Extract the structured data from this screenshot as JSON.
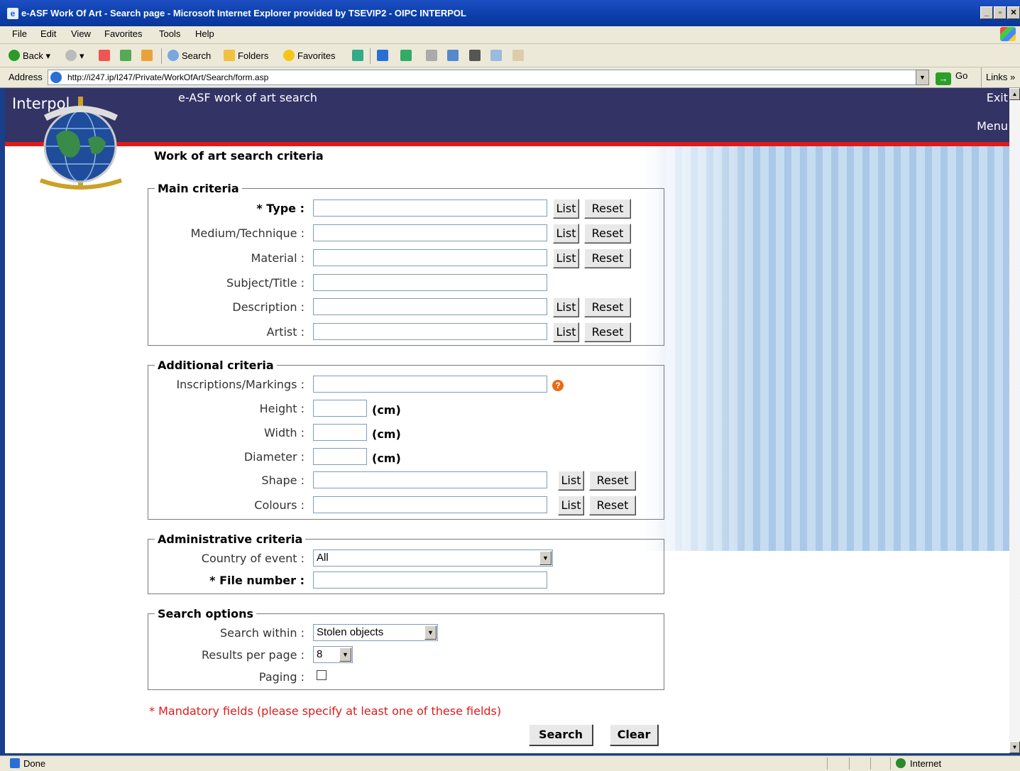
{
  "window": {
    "title": "e-ASF Work Of Art - Search page - Microsoft Internet Explorer provided by TSEVIP2 - OIPC INTERPOL",
    "controls": [
      "_",
      "▫",
      "✕"
    ]
  },
  "menubar": [
    "File",
    "Edit",
    "View",
    "Favorites",
    "Tools",
    "Help"
  ],
  "toolbar": {
    "back": "Back",
    "search": "Search",
    "folders": "Folders",
    "favorites": "Favorites"
  },
  "addressbar": {
    "label": "Address",
    "url": "http://i247.ip/I247/Private/WorkOfArt/Search/form.asp",
    "go": "Go",
    "links": "Links"
  },
  "banner": {
    "brand": "Interpol",
    "app_title": "e-ASF work of art search",
    "exit": "Exit",
    "menu": "Menu"
  },
  "page_title": "Work of art search criteria",
  "main_criteria": {
    "legend": "Main criteria",
    "fields": [
      {
        "label": "* Type :",
        "list": "List",
        "reset": "Reset"
      },
      {
        "label": "Medium/Technique :",
        "list": "List",
        "reset": "Reset"
      },
      {
        "label": "Material :",
        "list": "List",
        "reset": "Reset"
      },
      {
        "label": "Subject/Title :"
      },
      {
        "label": "Description :",
        "list": "List",
        "reset": "Reset"
      },
      {
        "label": "Artist :",
        "list": "List",
        "reset": "Reset"
      }
    ]
  },
  "additional_criteria": {
    "legend": "Additional criteria",
    "inscriptions": "Inscriptions/Markings :",
    "help_glyph": "?",
    "height": "Height :",
    "width": "Width :",
    "diameter": "Diameter :",
    "unit": "(cm)",
    "shape": "Shape :",
    "colours": "Colours :",
    "list": "List",
    "reset": "Reset"
  },
  "administrative_criteria": {
    "legend": "Administrative criteria",
    "country_label": "Country of event :",
    "country_value": "All",
    "file_number_label": "* File number :"
  },
  "search_options": {
    "legend": "Search options",
    "search_within_label": "Search within :",
    "search_within_value": "Stolen objects",
    "results_label": "Results per page :",
    "results_value": "8",
    "paging_label": "Paging :",
    "paging_checked": false
  },
  "mandatory_note": "* Mandatory fields (please specify at least one of these fields)",
  "actions": {
    "search": "Search",
    "clear": "Clear"
  },
  "statusbar": {
    "status": "Done",
    "zone": "Internet"
  },
  "colors": {
    "banner": "#333366",
    "accent_red": "#e01a1a",
    "titlebar": "#0b3ea8"
  }
}
